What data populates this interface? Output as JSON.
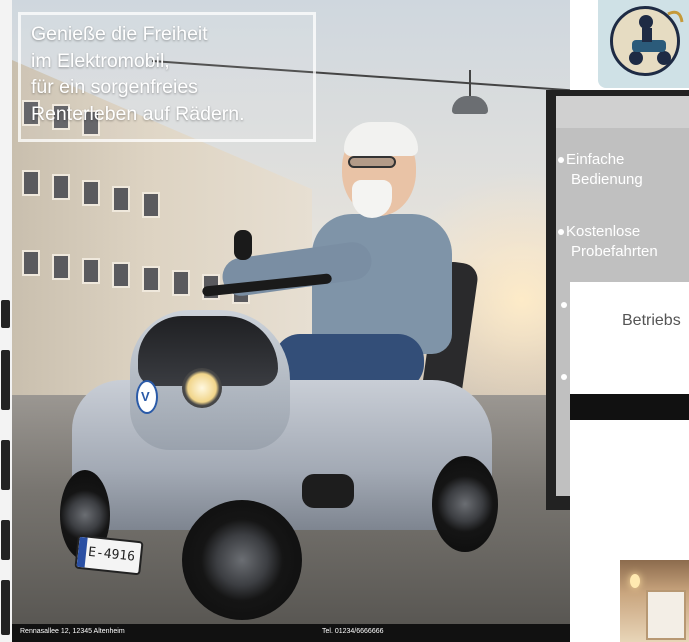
{
  "poster": {
    "headline_lines": [
      "Genieße die Freiheit",
      "im Elektromobil,",
      "für ein sorgenfreies",
      "Renterleben auf Rädern."
    ],
    "license_plate": "E-4916",
    "footer_address": "Rennasallee 12, 12345 Altenheim",
    "footer_phone": "Tel. 01234/6666666"
  },
  "right_panel": {
    "bullets": [
      {
        "line1": "Einfache",
        "line2": "Bedienung"
      },
      {
        "line1": "Kostenlose",
        "line2": "Probefahrten"
      }
    ],
    "partial_heading": "Betriebs"
  },
  "colors": {
    "headline_text": "#ffffff",
    "frame_dark": "#222222",
    "panel_gray": "#c0c0c0",
    "footer_bg": "#111111"
  },
  "icons": {
    "logo": "scooter-rider-logo-icon",
    "scooter_badge": "vehicle-brand-logo-icon"
  }
}
